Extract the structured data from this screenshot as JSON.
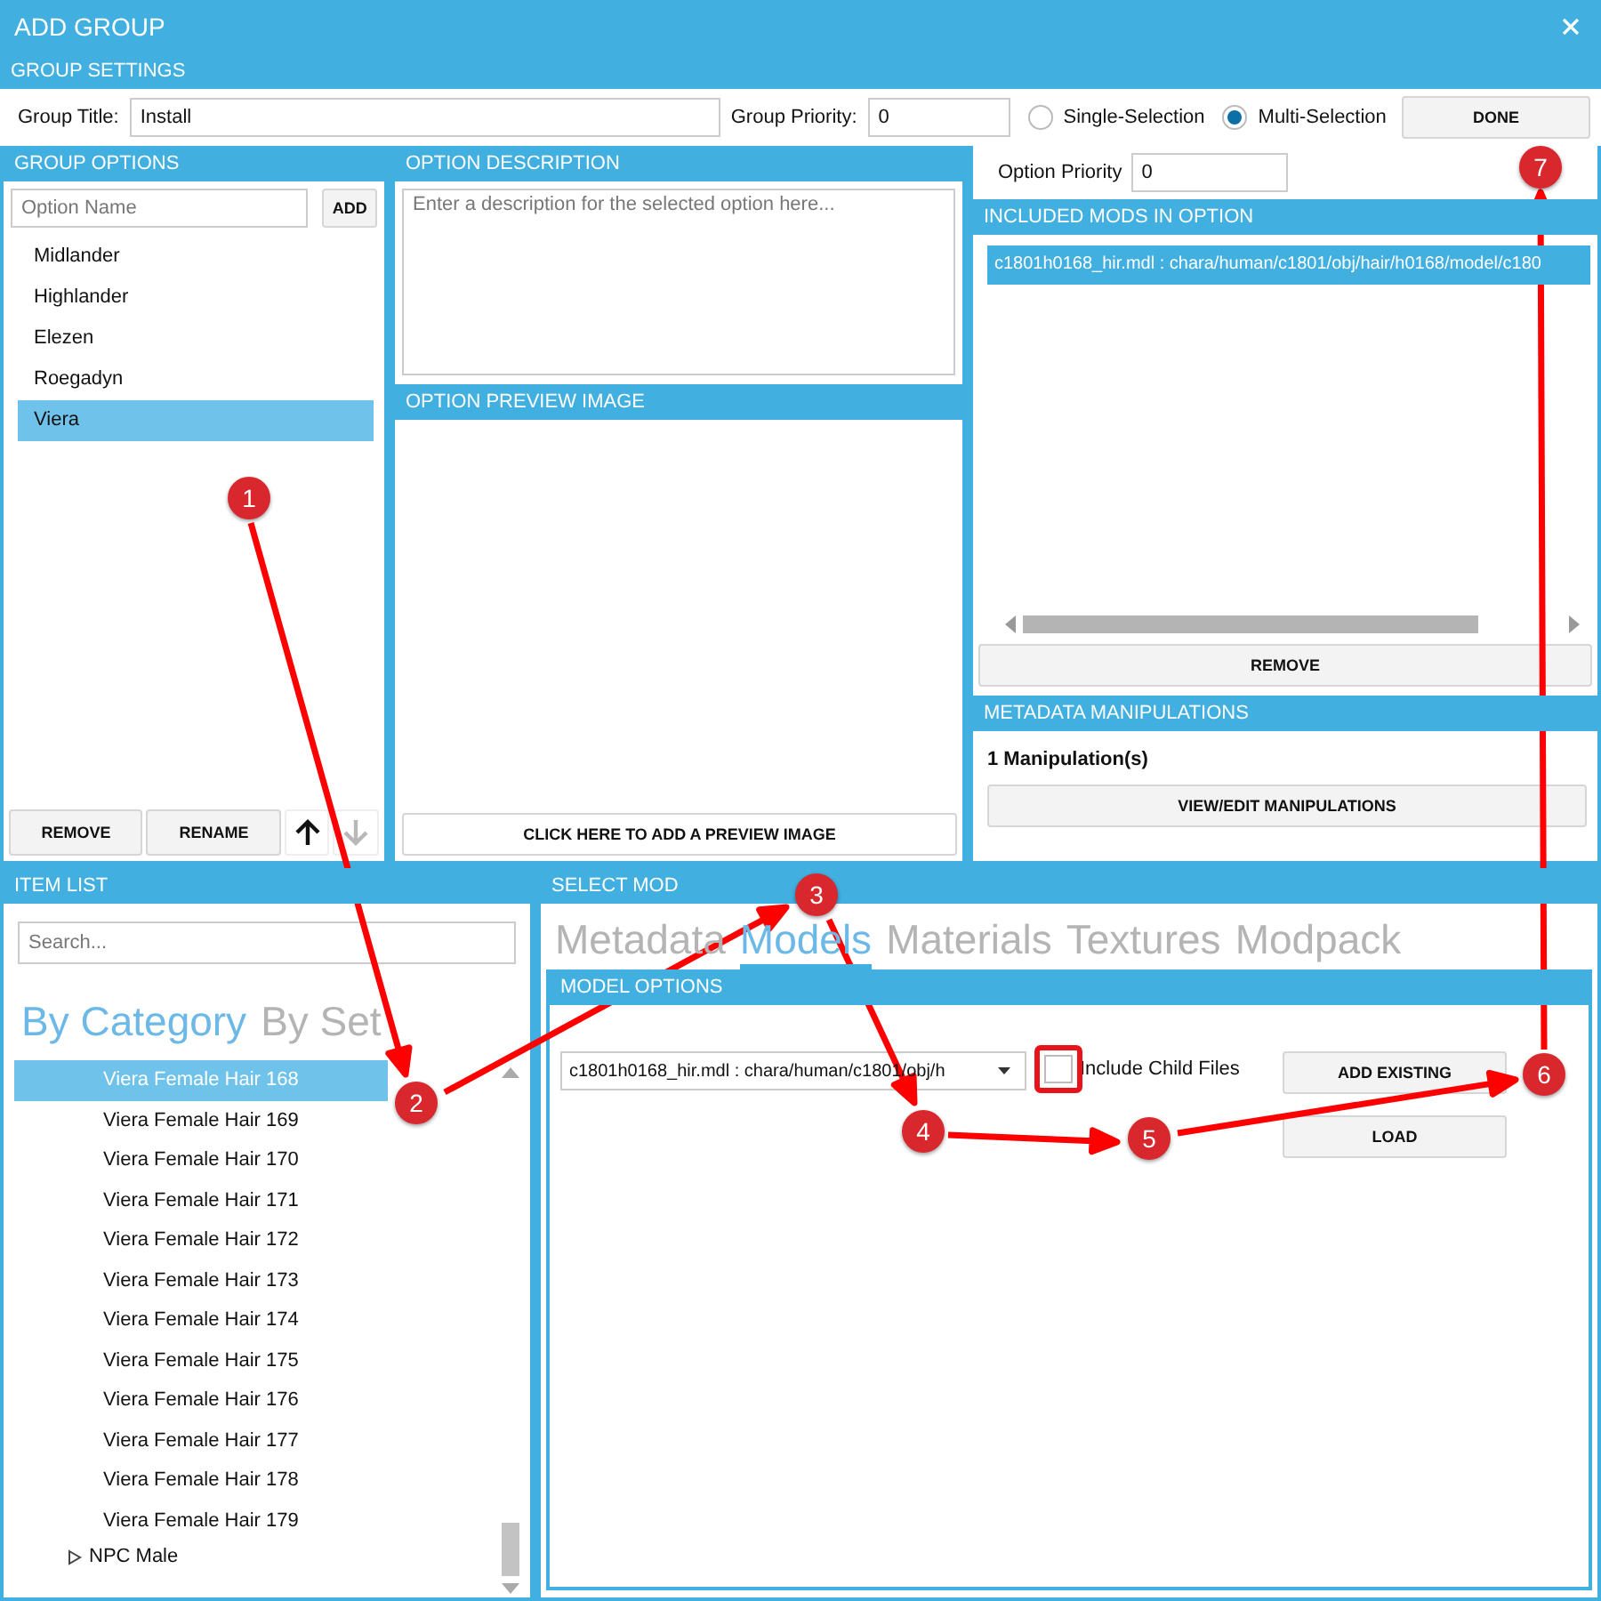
{
  "window": {
    "title": "ADD GROUP"
  },
  "group_settings": {
    "header": "GROUP SETTINGS",
    "title_label": "Group Title:",
    "title_value": "Install",
    "priority_label": "Group Priority:",
    "priority_value": "0",
    "modes": [
      {
        "label": "Single-Selection",
        "selected": false
      },
      {
        "label": "Multi-Selection",
        "selected": true
      }
    ],
    "done_button": "DONE"
  },
  "group_options": {
    "header": "GROUP OPTIONS",
    "name_field": {
      "placeholder": "Option Name"
    },
    "add_button": "ADD",
    "options": [
      {
        "label": "Midlander",
        "selected": false
      },
      {
        "label": "Highlander",
        "selected": false
      },
      {
        "label": "Elezen",
        "selected": false
      },
      {
        "label": "Roegadyn",
        "selected": false
      },
      {
        "label": "Viera",
        "selected": true
      }
    ],
    "buttons": [
      "REMOVE",
      "RENAME"
    ],
    "move_buttons": [
      {
        "kind": "up",
        "disabled": false
      },
      {
        "kind": "down",
        "disabled": true
      }
    ]
  },
  "option_description": {
    "header": "OPTION DESCRIPTION",
    "field": {
      "placeholder": "Enter a description for the selected option here..."
    }
  },
  "option_preview": {
    "header": "OPTION PREVIEW IMAGE",
    "button": "CLICK HERE TO ADD A PREVIEW IMAGE"
  },
  "option_priority": {
    "label": "Option Priority",
    "value": "0"
  },
  "included_mods": {
    "header": "INCLUDED MODS IN OPTION",
    "items": [
      {
        "label": "c1801h0168_hir.mdl : chara/human/c1801/obj/hair/h0168/model/c180",
        "selected": true
      }
    ],
    "remove_button": "REMOVE"
  },
  "metadata": {
    "header": "METADATA MANIPULATIONS",
    "count": "1 Manipulation(s)",
    "button": "VIEW/EDIT MANIPULATIONS"
  },
  "item_list": {
    "header": "ITEM LIST",
    "search": {
      "placeholder": "Search..."
    },
    "tabs": [
      {
        "label": "By Category",
        "selected": true
      },
      {
        "label": "By Set",
        "selected": false
      }
    ],
    "tree": [
      {
        "kind": "item",
        "label": "Viera Female Hair 168",
        "selected": true
      },
      {
        "kind": "item",
        "label": "Viera Female Hair 169",
        "selected": false
      },
      {
        "kind": "item",
        "label": "Viera Female Hair 170",
        "selected": false
      },
      {
        "kind": "item",
        "label": "Viera Female Hair 171",
        "selected": false
      },
      {
        "kind": "item",
        "label": "Viera Female Hair 172",
        "selected": false
      },
      {
        "kind": "item",
        "label": "Viera Female Hair 173",
        "selected": false
      },
      {
        "kind": "item",
        "label": "Viera Female Hair 174",
        "selected": false
      },
      {
        "kind": "item",
        "label": "Viera Female Hair 175",
        "selected": false
      },
      {
        "kind": "item",
        "label": "Viera Female Hair 176",
        "selected": false
      },
      {
        "kind": "item",
        "label": "Viera Female Hair 177",
        "selected": false
      },
      {
        "kind": "item",
        "label": "Viera Female Hair 178",
        "selected": false
      },
      {
        "kind": "item",
        "label": "Viera Female Hair 179",
        "selected": false
      },
      {
        "kind": "category",
        "label": "NPC Male",
        "selected": false,
        "expanded": false
      }
    ]
  },
  "select_mod": {
    "header": "SELECT MOD",
    "tabs": [
      {
        "label": "Metadata",
        "selected": false
      },
      {
        "label": "Models",
        "selected": true
      },
      {
        "label": "Materials",
        "selected": false
      },
      {
        "label": "Textures",
        "selected": false
      },
      {
        "label": "Modpack",
        "selected": false
      }
    ],
    "model_options": {
      "header": "MODEL OPTIONS",
      "model_value": "c1801h0168_hir.mdl : chara/human/c1801/obj/h",
      "include_child": {
        "label": "Include Child Files",
        "checked": false
      },
      "buttons": [
        "ADD EXISTING",
        "LOAD"
      ]
    }
  },
  "annotations": [
    {
      "label": "1"
    },
    {
      "label": "2"
    },
    {
      "label": "3"
    },
    {
      "label": "4"
    },
    {
      "label": "5"
    },
    {
      "label": "6"
    },
    {
      "label": "7"
    }
  ]
}
